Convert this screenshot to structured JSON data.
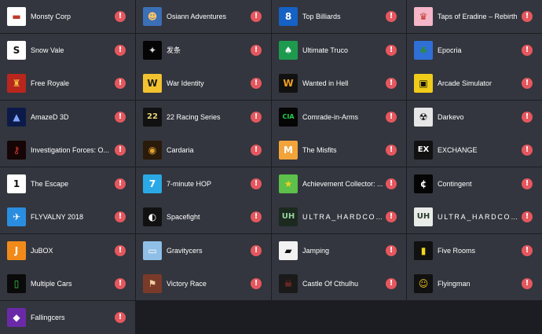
{
  "warning_glyph": "!",
  "warning_color": "#e5575e",
  "tile_background": "#33363e",
  "page_background": "#1b1d22",
  "games": [
    {
      "title": "Monsty Corp",
      "icon": "monsty-corp-icon",
      "glyph": "▬",
      "bg": "#ffffff",
      "fg": "#c0392b"
    },
    {
      "title": "Osiann Adventures",
      "icon": "osiann-adventures-icon",
      "glyph": "☻",
      "bg": "#3b6fb6",
      "fg": "#f3c26b"
    },
    {
      "title": "Top Billiards",
      "icon": "top-billiards-icon",
      "glyph": "8",
      "bg": "#1561c4",
      "fg": "#ffffff"
    },
    {
      "title": "Taps of Eradine – Rebirth",
      "icon": "taps-of-eradine-icon",
      "glyph": "♛",
      "bg": "#f4b6c8",
      "fg": "#c0392b"
    },
    {
      "title": "Snow Vale",
      "icon": "snow-vale-icon",
      "glyph": "S",
      "bg": "#ffffff",
      "fg": "#111111"
    },
    {
      "title": "发条",
      "icon": "clockwork-icon",
      "glyph": "✦",
      "bg": "#050505",
      "fg": "#d9d9d9"
    },
    {
      "title": "Ultimate Truco",
      "icon": "ultimate-truco-icon",
      "glyph": "♠",
      "bg": "#1e9a4f",
      "fg": "#ffffff"
    },
    {
      "title": "Epocria",
      "icon": "epocria-icon",
      "glyph": "♣",
      "bg": "#2f6fd6",
      "fg": "#2e8b3c"
    },
    {
      "title": "Free Royale",
      "icon": "free-royale-icon",
      "glyph": "♜",
      "bg": "#b8261e",
      "fg": "#f0c040"
    },
    {
      "title": "War Identity",
      "icon": "war-identity-icon",
      "glyph": "W",
      "bg": "#f2c230",
      "fg": "#1a1a1a"
    },
    {
      "title": "Wanted in Hell",
      "icon": "wanted-in-hell-icon",
      "glyph": "W",
      "bg": "#111111",
      "fg": "#f0a020"
    },
    {
      "title": "Arcade Simulator",
      "icon": "arcade-simulator-icon",
      "glyph": "▣",
      "bg": "#f0cc1a",
      "fg": "#111111"
    },
    {
      "title": "AmazeD 3D",
      "icon": "amazed-3d-icon",
      "glyph": "▲",
      "bg": "#0c1a4a",
      "fg": "#7ea6ff"
    },
    {
      "title": "22 Racing Series",
      "icon": "22-racing-series-icon",
      "glyph": "22",
      "bg": "#111111",
      "fg": "#e8d27a"
    },
    {
      "title": "Comrade-in-Arms",
      "icon": "comrade-in-arms-icon",
      "glyph": "CIA",
      "bg": "#050505",
      "fg": "#22d24a"
    },
    {
      "title": "Darkevo",
      "icon": "darkevo-icon",
      "glyph": "☢",
      "bg": "#e6e6e6",
      "fg": "#111111"
    },
    {
      "title": "Investigation Forces: O...",
      "icon": "investigation-forces-icon",
      "glyph": "⚷",
      "bg": "#160506",
      "fg": "#d63a2b"
    },
    {
      "title": "Cardaria",
      "icon": "cardaria-icon",
      "glyph": "◉",
      "bg": "#2a1a0a",
      "fg": "#e0a030"
    },
    {
      "title": "The Misfits",
      "icon": "the-misfits-icon",
      "glyph": "M",
      "bg": "#f2a43a",
      "fg": "#ffffff"
    },
    {
      "title": "EXCHANGE",
      "icon": "exchange-icon",
      "glyph": "EX",
      "bg": "#111111",
      "fg": "#ffffff"
    },
    {
      "title": "The Escape",
      "icon": "the-escape-icon",
      "glyph": "1",
      "bg": "#ffffff",
      "fg": "#111111"
    },
    {
      "title": "7-minute HOP",
      "icon": "7-minute-hop-icon",
      "glyph": "7",
      "bg": "#2aa9e6",
      "fg": "#ffffff"
    },
    {
      "title": "Achievement Collector: ...",
      "icon": "achievement-collector-icon",
      "glyph": "★",
      "bg": "#5cc04a",
      "fg": "#f0d020"
    },
    {
      "title": "Contingent",
      "icon": "contingent-icon",
      "glyph": "¢",
      "bg": "#050505",
      "fg": "#ffffff"
    },
    {
      "title": "FLYVALNY 2018",
      "icon": "flyvalny-2018-icon",
      "glyph": "✈",
      "bg": "#2a8de0",
      "fg": "#ffffff"
    },
    {
      "title": "Spacefight",
      "icon": "spacefight-icon",
      "glyph": "◐",
      "bg": "#111111",
      "fg": "#ffffff"
    },
    {
      "title": "ULTRA_HARDCO...",
      "icon": "ultra-hardcore-icon",
      "glyph": "UH",
      "bg": "#1b2a1e",
      "fg": "#9ad3a0"
    },
    {
      "title": "ULTRA_HARDCO...",
      "icon": "ultra-hardcore-light-icon",
      "glyph": "UH",
      "bg": "#e9ece9",
      "fg": "#2a3a2a"
    },
    {
      "title": "JuBOX",
      "icon": "jubox-icon",
      "glyph": "J",
      "bg": "#f28a1a",
      "fg": "#ffffff"
    },
    {
      "title": "Gravitycers",
      "icon": "gravitycers-icon",
      "glyph": "▭",
      "bg": "#8fbfe6",
      "fg": "#ffffff"
    },
    {
      "title": "Jamping",
      "icon": "jamping-icon",
      "glyph": "▰",
      "bg": "#f2f2f2",
      "fg": "#111111"
    },
    {
      "title": "Five Rooms",
      "icon": "five-rooms-icon",
      "glyph": "▮",
      "bg": "#111111",
      "fg": "#f2d81a"
    },
    {
      "title": "Multiple Cars",
      "icon": "multiple-cars-icon",
      "glyph": "▯",
      "bg": "#0a0a0a",
      "fg": "#38d14a"
    },
    {
      "title": "Victory Race",
      "icon": "victory-race-icon",
      "glyph": "⚑",
      "bg": "#7a3a2a",
      "fg": "#f0d0a0"
    },
    {
      "title": "Castle Of Cthulhu",
      "icon": "castle-of-cthulhu-icon",
      "glyph": "☠",
      "bg": "#1a1a1a",
      "fg": "#c83a2a"
    },
    {
      "title": "Flyingman",
      "icon": "flyingman-icon",
      "glyph": "☺",
      "bg": "#111111",
      "fg": "#f2c21a"
    },
    {
      "title": "Fallingcers",
      "icon": "fallingcers-icon",
      "glyph": "◆",
      "bg": "#6a2aa8",
      "fg": "#ffffff"
    }
  ]
}
